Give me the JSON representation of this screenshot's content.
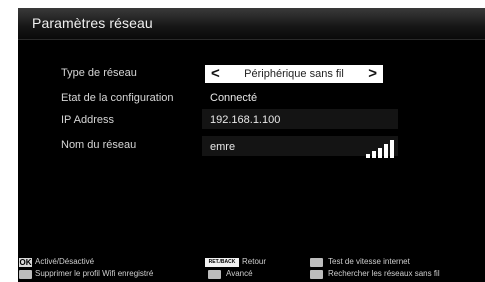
{
  "title": "Paramètres réseau",
  "rows": [
    {
      "label": "Type de réseau",
      "value": "Périphérique sans fil"
    },
    {
      "label": "Etat de la configuration",
      "value": "Connecté"
    },
    {
      "label": "IP Address",
      "value": "192.168.1.100"
    },
    {
      "label": "Nom du réseau",
      "value": "emre"
    }
  ],
  "selector": {
    "left_arrow": "<",
    "right_arrow": ">"
  },
  "signal": {
    "icon": "wifi-signal-icon",
    "bars_filled": 5,
    "bars_total": 5
  },
  "footer": {
    "ok_key": "OK",
    "ok_label": "Activé/Désactivé",
    "ret_key": "RET./BACK",
    "ret_label": "Retour",
    "gray1_label": "Test de vitesse internet",
    "gray2_label": "Supprimer le profil Wifi enregistré",
    "gray3_label": "Avancé",
    "gray4_label": "Rechercher les réseaux sans fil"
  },
  "colors": {
    "panel": "#000000",
    "selector_bg": "#ffffff",
    "key_button": "#bdbdbd"
  }
}
